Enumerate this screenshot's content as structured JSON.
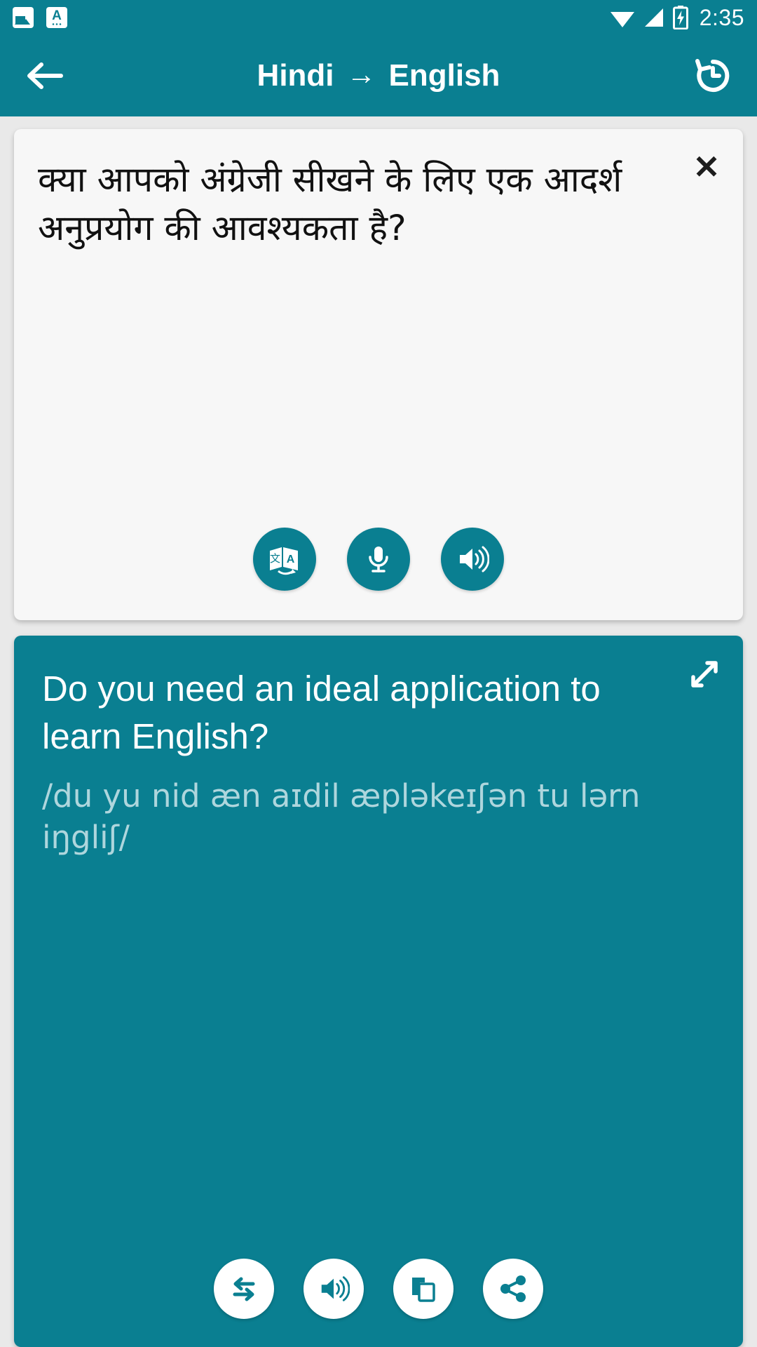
{
  "status_bar": {
    "time": "2:35",
    "notifications": [
      {
        "icon": "image-notification-icon"
      },
      {
        "icon": "translate-notification-icon",
        "letter": "A"
      }
    ],
    "indicators": [
      "wifi-icon",
      "signal-icon",
      "battery-charging-icon"
    ]
  },
  "app_bar": {
    "back_icon": "back-arrow-icon",
    "source_language": "Hindi",
    "arrow": "→",
    "target_language": "English",
    "history_icon": "history-icon"
  },
  "source_card": {
    "close_label": "✕",
    "text": "क्या आपको अंग्रेजी सीखने के लिए एक आदर्श अनुप्रयोग की आवश्यकता है?",
    "actions": [
      {
        "name": "translate-language-button",
        "icon": "translate-icon"
      },
      {
        "name": "microphone-button",
        "icon": "microphone-icon"
      },
      {
        "name": "speak-source-button",
        "icon": "speaker-icon"
      }
    ]
  },
  "result_card": {
    "expand_icon": "expand-fullscreen-icon",
    "translation": "Do you need an ideal application to learn English?",
    "phonetic": "/du yu nid æn aɪdil æpləkeɪʃən tu lərn iŋgliʃ/",
    "actions": [
      {
        "name": "swap-languages-button",
        "icon": "swap-arrows-icon"
      },
      {
        "name": "speak-translation-button",
        "icon": "speaker-icon"
      },
      {
        "name": "copy-button",
        "icon": "copy-icon"
      },
      {
        "name": "share-button",
        "icon": "share-icon"
      }
    ]
  },
  "colors": {
    "primary_teal": "#0a7f91",
    "card_light": "#f7f7f7",
    "page_background": "#e9e9e9",
    "phonetic_text": "#aed6dd"
  }
}
